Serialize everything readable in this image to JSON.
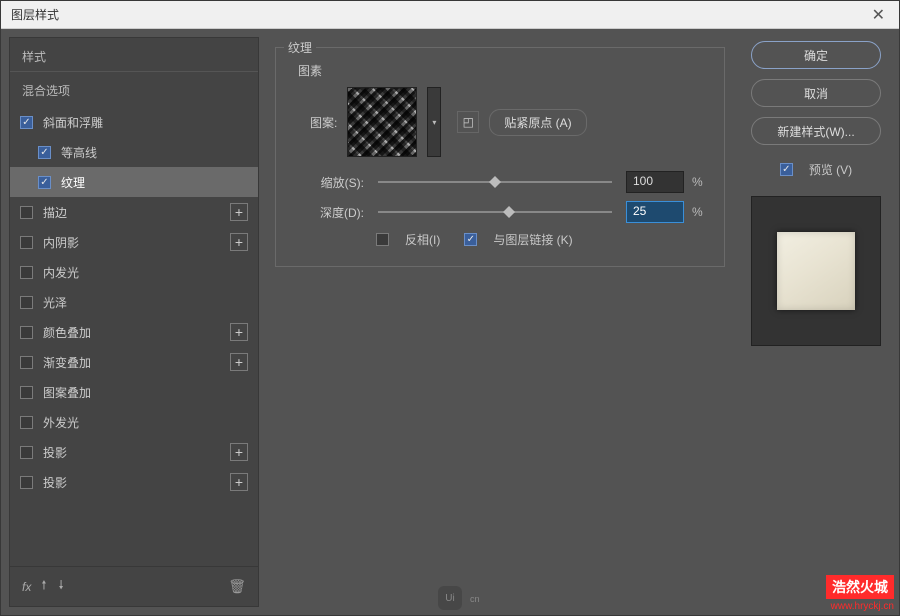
{
  "window": {
    "title": "图层样式"
  },
  "sidebar": {
    "header1": "样式",
    "header2": "混合选项",
    "items": [
      {
        "label": "斜面和浮雕",
        "checked": true,
        "indent": false,
        "hasAdd": false
      },
      {
        "label": "等高线",
        "checked": true,
        "indent": true,
        "hasAdd": false
      },
      {
        "label": "纹理",
        "checked": true,
        "indent": true,
        "hasAdd": false,
        "active": true
      },
      {
        "label": "描边",
        "checked": false,
        "indent": false,
        "hasAdd": true
      },
      {
        "label": "内阴影",
        "checked": false,
        "indent": false,
        "hasAdd": true
      },
      {
        "label": "内发光",
        "checked": false,
        "indent": false,
        "hasAdd": false
      },
      {
        "label": "光泽",
        "checked": false,
        "indent": false,
        "hasAdd": false
      },
      {
        "label": "颜色叠加",
        "checked": false,
        "indent": false,
        "hasAdd": true
      },
      {
        "label": "渐变叠加",
        "checked": false,
        "indent": false,
        "hasAdd": true
      },
      {
        "label": "图案叠加",
        "checked": false,
        "indent": false,
        "hasAdd": false
      },
      {
        "label": "外发光",
        "checked": false,
        "indent": false,
        "hasAdd": false
      },
      {
        "label": "投影",
        "checked": false,
        "indent": false,
        "hasAdd": true
      },
      {
        "label": "投影",
        "checked": false,
        "indent": false,
        "hasAdd": true
      }
    ],
    "fx_label": "fx"
  },
  "texture": {
    "group_title": "纹理",
    "subgroup_title": "图素",
    "pattern_label": "图案:",
    "snap_origin_label": "贴紧原点 (A)",
    "scale_label": "缩放(S):",
    "scale_value": "100",
    "scale_pct": 50,
    "depth_label": "深度(D):",
    "depth_value": "25",
    "depth_pct": 56,
    "invert_label": "反相(I)",
    "invert_checked": false,
    "link_label": "与图层链接 (K)",
    "link_checked": true,
    "unit": "%"
  },
  "right": {
    "ok": "确定",
    "cancel": "取消",
    "new_style": "新建样式(W)...",
    "preview_label": "预览 (V)",
    "preview_checked": true
  },
  "watermark": {
    "main": "浩然火城",
    "url": "www.hryckj.cn"
  },
  "logo": {
    "text": "Ui",
    "cn": "cn"
  }
}
